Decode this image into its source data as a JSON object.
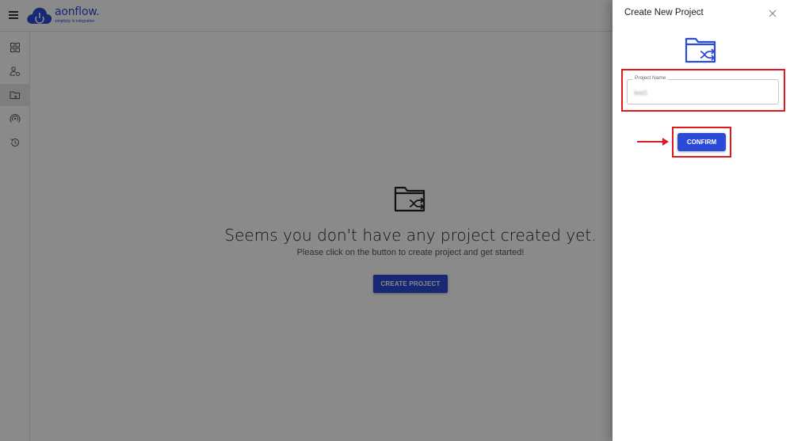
{
  "app": {
    "logo_name": "aonflow.",
    "logo_tagline": "simplicity in integration",
    "brand_color": "#2c4ad8"
  },
  "sidebar": {
    "items": [
      {
        "icon": "dashboard-grid-icon"
      },
      {
        "icon": "user-settings-icon"
      },
      {
        "icon": "project-folder-icon",
        "active": true
      },
      {
        "icon": "broadcast-icon"
      },
      {
        "icon": "history-icon"
      }
    ]
  },
  "main": {
    "empty_title": "Seems you don't have any project created yet.",
    "empty_subtitle": "Please click on the button to create project and get started!",
    "create_button": "CREATE PROJECT"
  },
  "drawer": {
    "title": "Create New Project",
    "field_label": "Project Name",
    "field_value": "test1",
    "confirm_button": "CONFIRM",
    "highlight_color": "#e0181f"
  }
}
